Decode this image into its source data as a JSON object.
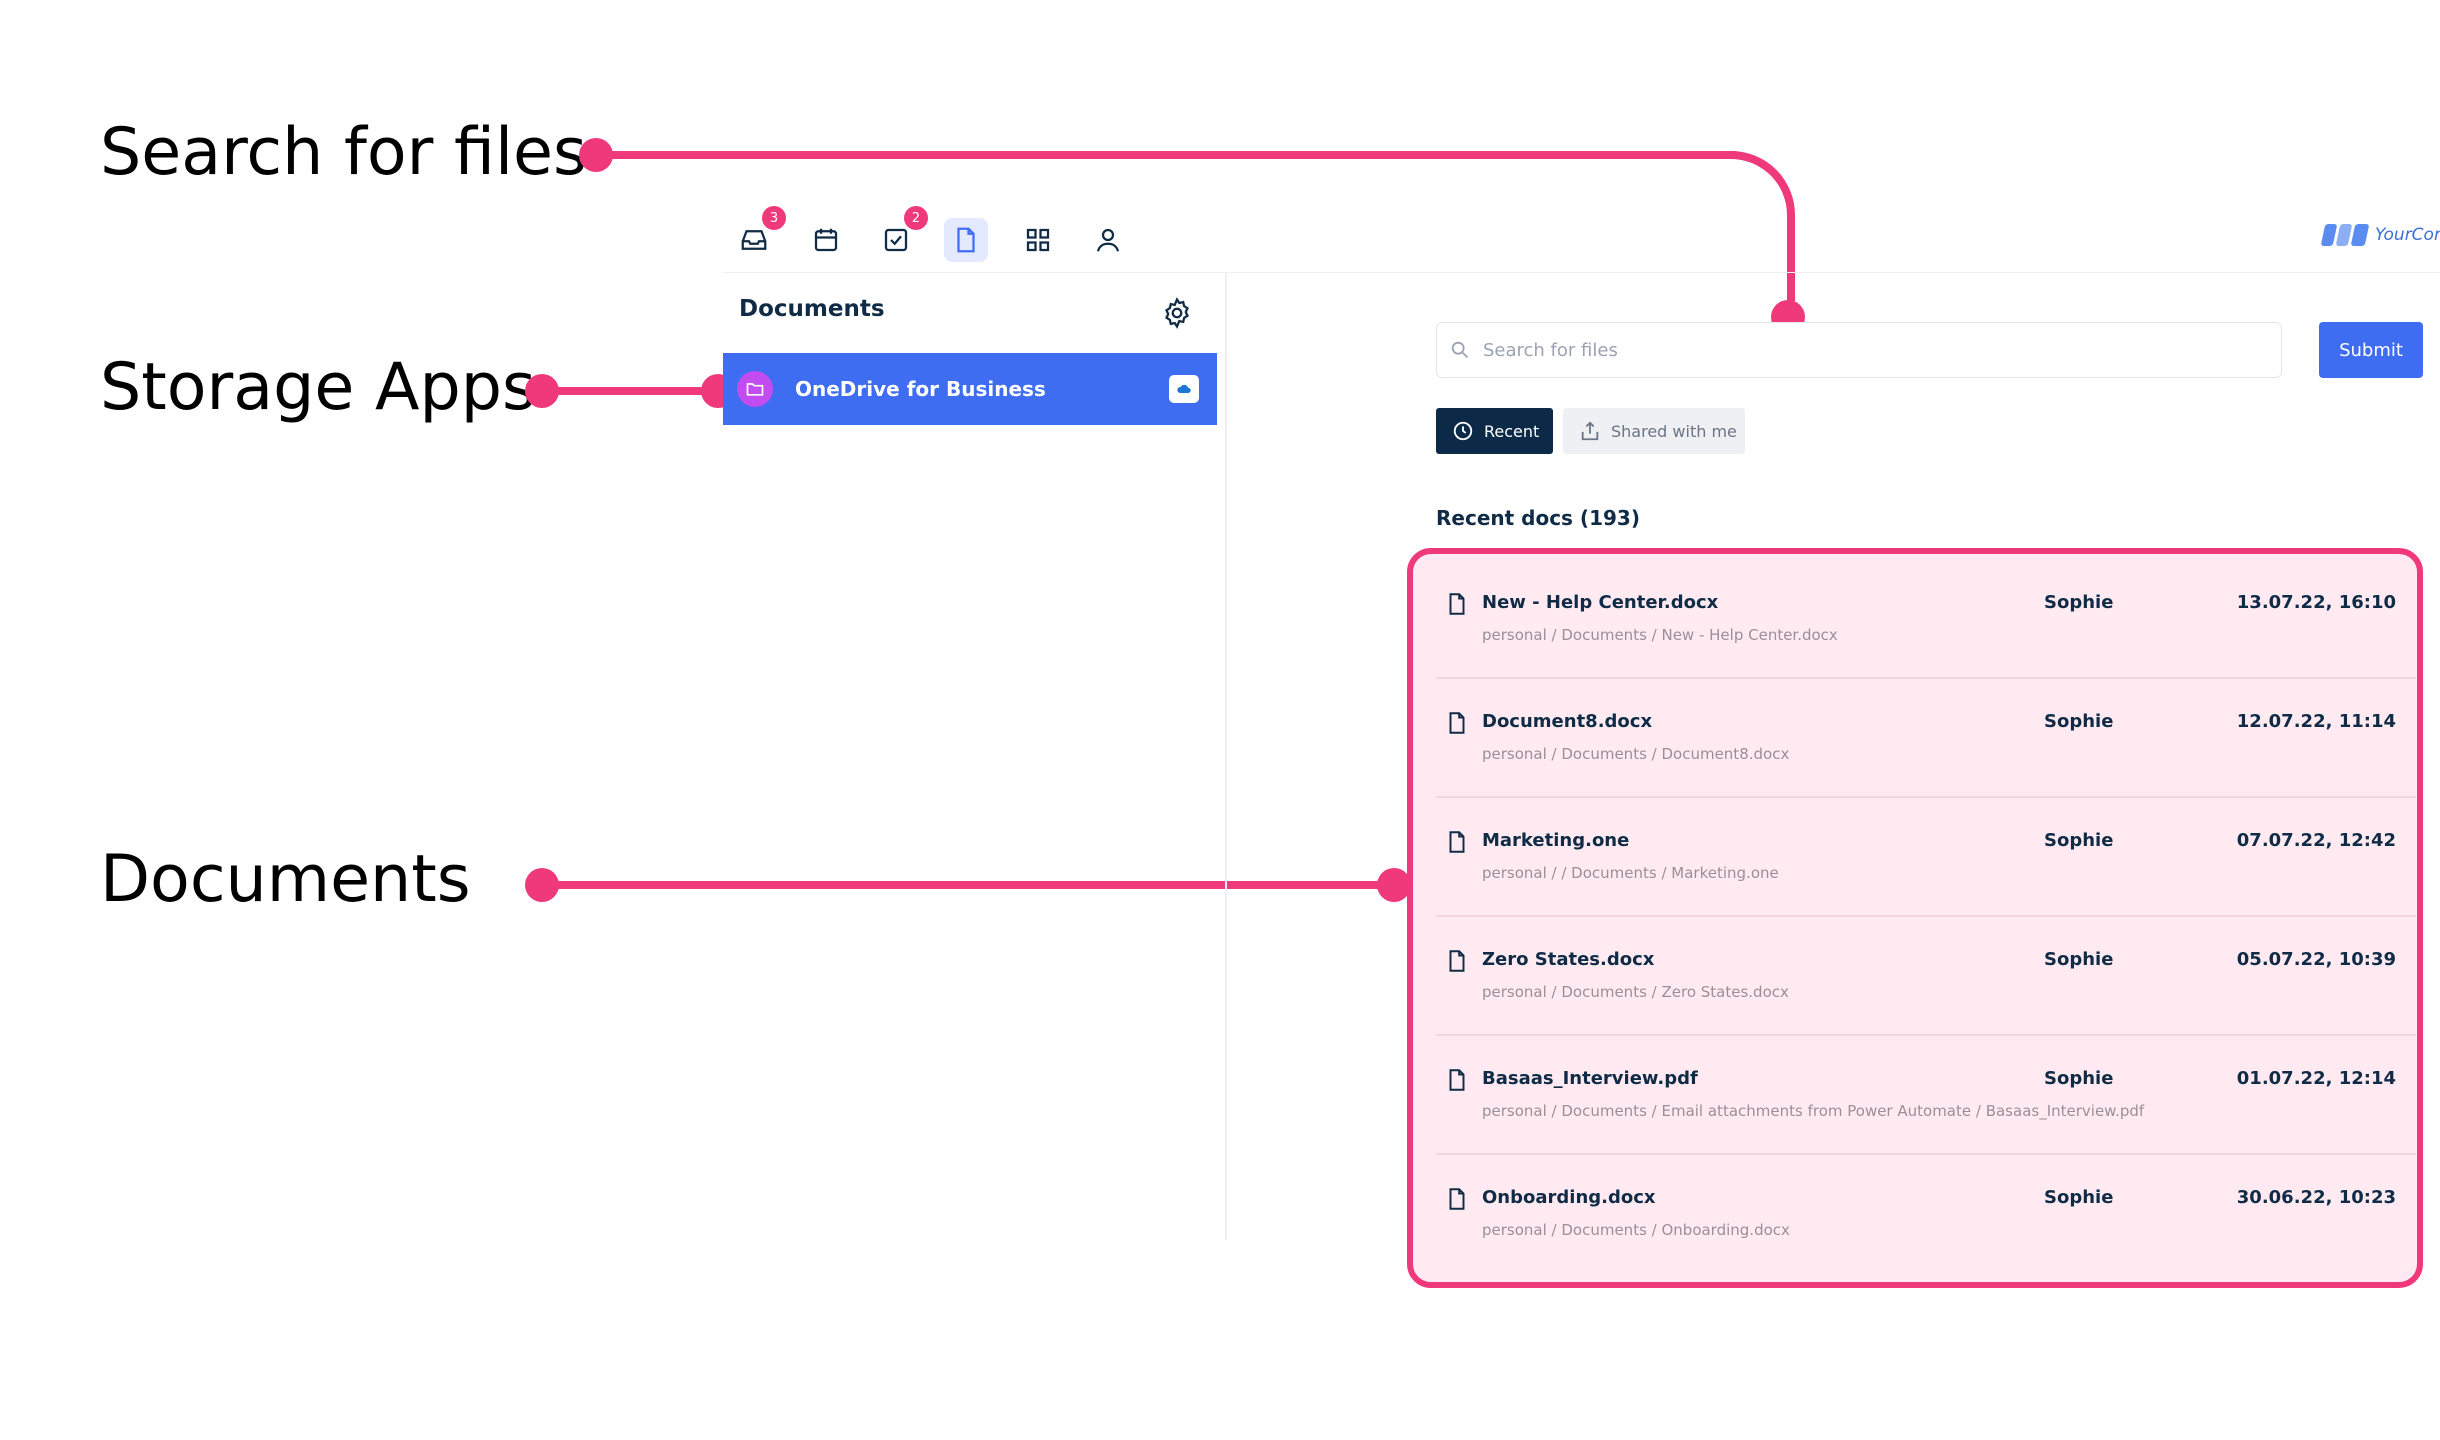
{
  "annotations": {
    "search": "Search for files",
    "storage": "Storage Apps",
    "documents": "Documents"
  },
  "topbar": {
    "icons": [
      {
        "name": "inbox-icon",
        "badge": "3"
      },
      {
        "name": "calendar-icon",
        "badge": ""
      },
      {
        "name": "tasks-icon",
        "badge": "2"
      },
      {
        "name": "documents-icon",
        "badge": ""
      },
      {
        "name": "apps-grid-icon",
        "badge": ""
      },
      {
        "name": "user-icon",
        "badge": ""
      }
    ],
    "logo_text": "YourCom"
  },
  "sidebar": {
    "title": "Documents",
    "settings_icon": "gear-icon",
    "storage_item": "OneDrive for Business"
  },
  "search": {
    "placeholder": "Search for files",
    "submit_label": "Submit"
  },
  "tabs": {
    "recent": "Recent",
    "shared": "Shared with me"
  },
  "recent_title": "Recent docs (193)",
  "documents": [
    {
      "name": "New - Help Center.docx",
      "path": "personal / Documents / New - Help Center.docx",
      "owner": "Sophie",
      "date": "13.07.22, 16:10"
    },
    {
      "name": "Document8.docx",
      "path": "personal / Documents / Document8.docx",
      "owner": "Sophie",
      "date": "12.07.22, 11:14"
    },
    {
      "name": "Marketing.one",
      "path": "personal / / Documents / Marketing.one",
      "owner": "Sophie",
      "date": "07.07.22, 12:42"
    },
    {
      "name": "Zero States.docx",
      "path": "personal / Documents / Zero States.docx",
      "owner": "Sophie",
      "date": "05.07.22, 10:39"
    },
    {
      "name": "Basaas_Interview.pdf",
      "path": "personal / Documents / Email attachments from Power Automate / Basaas_Interview.pdf",
      "owner": "Sophie",
      "date": "01.07.22, 12:14"
    },
    {
      "name": "Onboarding.docx",
      "path": "personal / Documents / Onboarding.docx",
      "owner": "Sophie",
      "date": "30.06.22, 10:23"
    }
  ],
  "colors": {
    "accent": "#3f6df2",
    "annotation": "#f0397a",
    "highlight_bg": "#ffeaf1",
    "dark_tab": "#0c2a47"
  }
}
